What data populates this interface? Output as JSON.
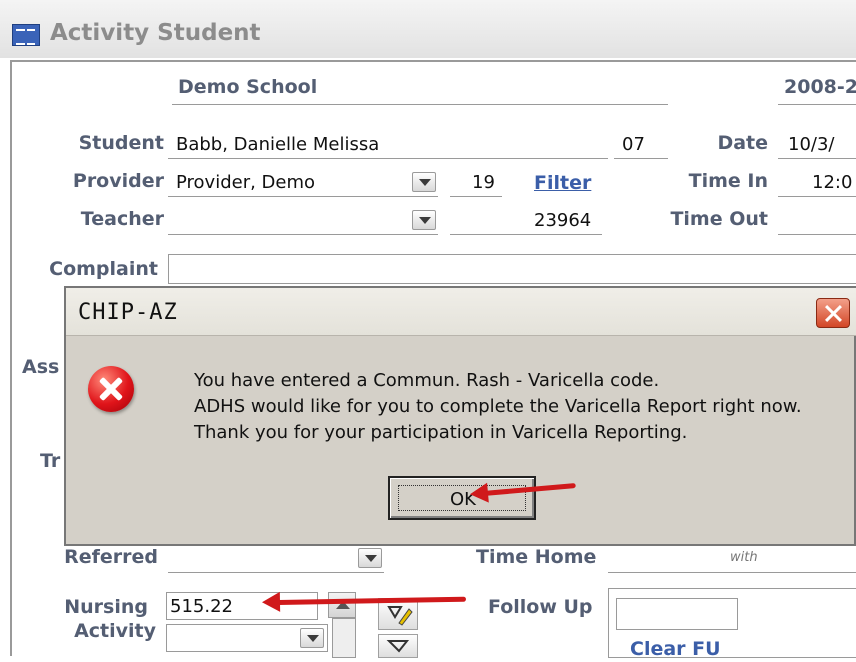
{
  "window": {
    "title": "Activity Student",
    "icon": "form-icon"
  },
  "header": {
    "school": "Demo School",
    "year": "2008-2"
  },
  "student": {
    "label": "Student",
    "name": "Babb, Danielle Melissa",
    "grade": "07"
  },
  "date": {
    "label": "Date",
    "value": "10/3/"
  },
  "provider": {
    "label": "Provider",
    "name": "Provider, Demo",
    "number": "19",
    "filter_link": "Filter"
  },
  "time_in": {
    "label": "Time In",
    "value": "12:0"
  },
  "teacher": {
    "label": "Teacher",
    "name": "",
    "number": "23964"
  },
  "time_out": {
    "label": "Time Out",
    "value": ""
  },
  "complaint": {
    "label": "Complaint",
    "value": ""
  },
  "partial_labels": {
    "ass": "Ass",
    "tr": "Tr"
  },
  "referred": {
    "label": "Referred",
    "value": ""
  },
  "time_home": {
    "label": "Time Home",
    "with_label": "with"
  },
  "nursing": {
    "label_line1": "Nursing",
    "label_line2": "Activity",
    "code": "515.22",
    "activity": ""
  },
  "follow_up": {
    "label": "Follow Up",
    "clear_button": "Clear FU"
  },
  "dialog": {
    "title": "CHIP-AZ",
    "icon": "error-icon",
    "message_lines": [
      "You have entered a Commun. Rash - Varicella code.",
      "ADHS would like for you to complete the Varicella Report right now.",
      "Thank you for your participation in Varicella Reporting."
    ],
    "ok_label": "OK"
  },
  "colors": {
    "label": "#545e73",
    "arrow": "#d0191b",
    "dialog_bg": "#d4d0c8",
    "link": "#3b5ea8"
  }
}
